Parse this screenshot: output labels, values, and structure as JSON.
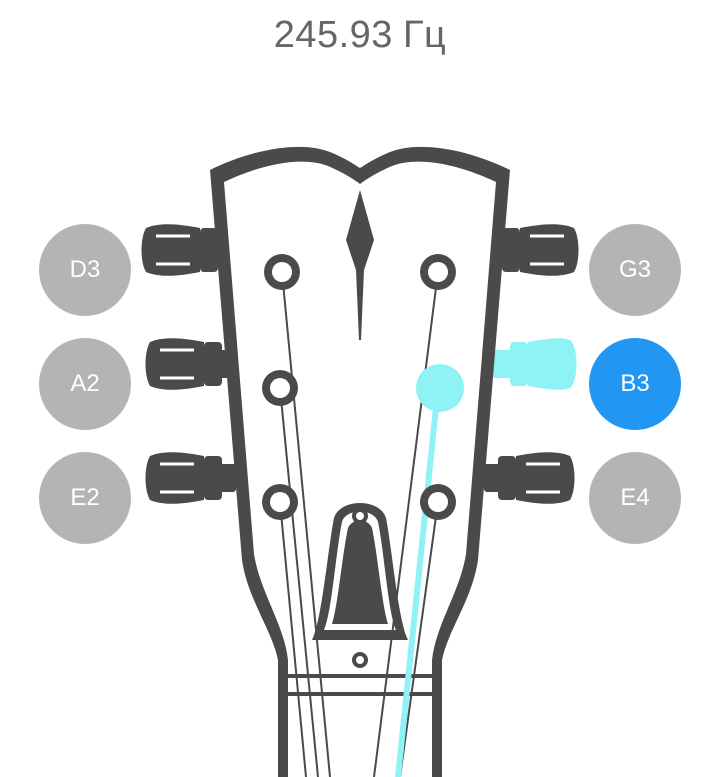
{
  "frequency": {
    "value": "245.93",
    "unit": "Гц"
  },
  "strings": {
    "left": [
      {
        "note": "D3",
        "active": false
      },
      {
        "note": "A2",
        "active": false
      },
      {
        "note": "E2",
        "active": false
      }
    ],
    "right": [
      {
        "note": "G3",
        "active": false
      },
      {
        "note": "B3",
        "active": true
      },
      {
        "note": "E4",
        "active": false
      }
    ]
  },
  "colors": {
    "button_inactive": "#b4b4b4",
    "button_active": "#2196f3",
    "highlight": "#8ff3f5",
    "headstock": "#4a4a4a",
    "frequency_text": "#666666"
  },
  "icons": {
    "tuning_peg": "tuning-peg-icon",
    "headstock": "guitar-headstock-icon"
  }
}
